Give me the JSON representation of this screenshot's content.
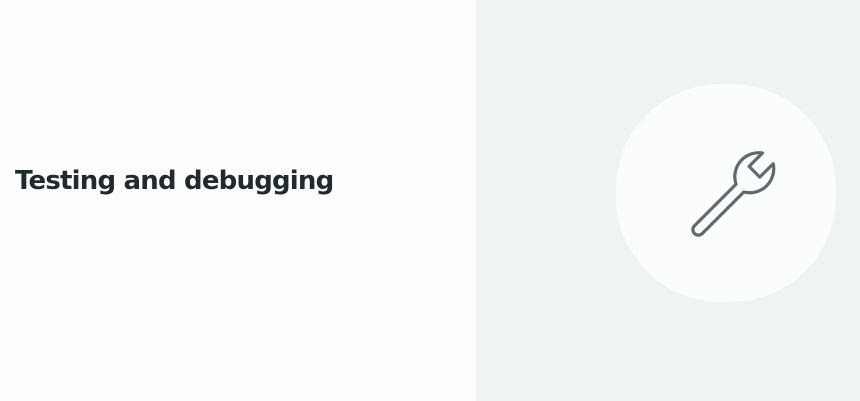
{
  "card": {
    "title": "Testing and debugging",
    "icon": "wrench-icon"
  },
  "colors": {
    "title_text": "#1f2b2e",
    "left_background": "#fdfdfd",
    "right_background": "#eef4f4",
    "badge_background": "#fbfcfc",
    "icon_stroke": "#5e6a6f"
  }
}
